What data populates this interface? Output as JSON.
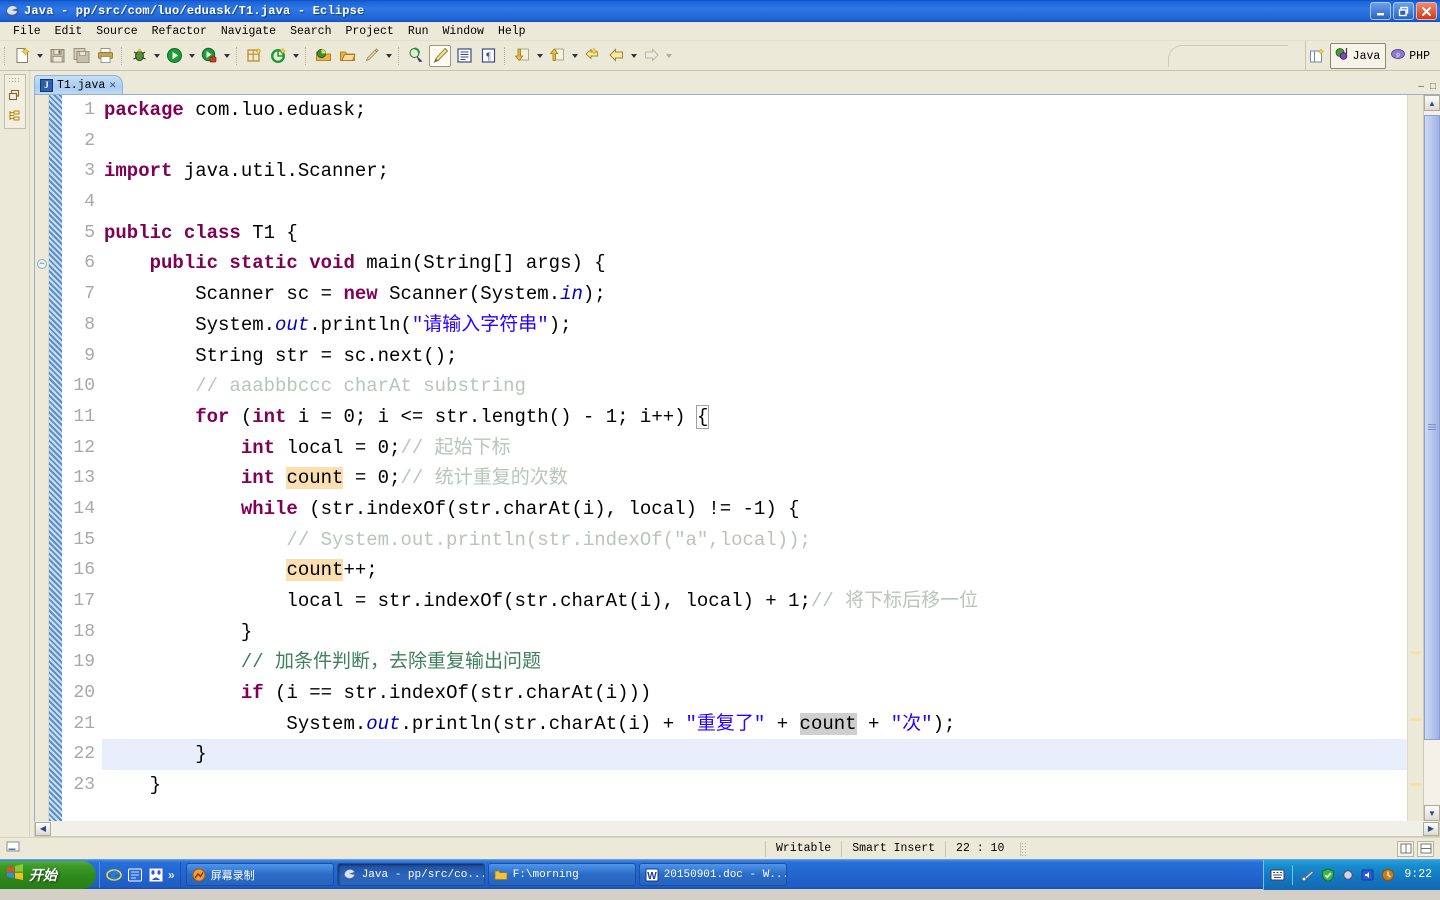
{
  "window": {
    "title": "Java - pp/src/com/luo/eduask/T1.java - Eclipse",
    "app_icon": "eclipse-icon",
    "minimize_label": "_",
    "restore_label": "❐",
    "close_label": "✕"
  },
  "menubar": {
    "items": [
      {
        "label": "File"
      },
      {
        "label": "Edit"
      },
      {
        "label": "Source"
      },
      {
        "label": "Refactor"
      },
      {
        "label": "Navigate"
      },
      {
        "label": "Search"
      },
      {
        "label": "Project"
      },
      {
        "label": "Run"
      },
      {
        "label": "Window"
      },
      {
        "label": "Help"
      }
    ]
  },
  "toolbar": {
    "buttons": [
      {
        "name": "new-wizard",
        "icon": "new-file-icon",
        "dropdown": true
      },
      {
        "name": "save",
        "icon": "save-icon",
        "dropdown": false
      },
      {
        "name": "save-all",
        "icon": "save-all-icon",
        "dropdown": false
      },
      {
        "name": "print",
        "icon": "print-icon",
        "dropdown": false
      },
      {
        "name": "debug",
        "icon": "debug-bug-icon",
        "dropdown": true
      },
      {
        "name": "run",
        "icon": "run-play-icon",
        "dropdown": true
      },
      {
        "name": "external-tools",
        "icon": "external-tools-icon",
        "dropdown": true
      },
      {
        "name": "new-java-package",
        "icon": "new-package-icon",
        "dropdown": false
      },
      {
        "name": "new-java-class",
        "icon": "new-class-icon",
        "dropdown": true
      },
      {
        "name": "open-type",
        "icon": "open-type-icon",
        "dropdown": false
      },
      {
        "name": "open-task",
        "icon": "open-task-icon",
        "dropdown": false
      },
      {
        "name": "search",
        "icon": "pencil-search-icon",
        "dropdown": true
      },
      {
        "name": "toggle-mark-occurrences",
        "icon": "mark-occurrences-icon",
        "dropdown": false
      },
      {
        "name": "toggle-block-selection",
        "icon": "block-selection-icon",
        "dropdown": false,
        "pressed": true
      },
      {
        "name": "show-whitespace",
        "icon": "whitespace-icon",
        "dropdown": false
      },
      {
        "name": "pilcrow",
        "icon": "pilcrow-icon",
        "dropdown": false
      },
      {
        "name": "next-annotation",
        "icon": "down-arrow-annotation-icon",
        "dropdown": true
      },
      {
        "name": "previous-annotation",
        "icon": "up-arrow-annotation-icon",
        "dropdown": true
      },
      {
        "name": "last-edit-location",
        "icon": "last-edit-icon",
        "dropdown": false
      },
      {
        "name": "back",
        "icon": "back-arrow-icon",
        "dropdown": true
      },
      {
        "name": "forward",
        "icon": "forward-arrow-icon",
        "dropdown": true
      }
    ]
  },
  "perspectives": {
    "open_label": "open-perspective-icon",
    "items": [
      {
        "label": "Java",
        "icon": "java-perspective-icon",
        "active": true
      },
      {
        "label": "PHP",
        "icon": "php-perspective-icon",
        "active": false
      }
    ]
  },
  "fastview": {
    "items": [
      {
        "name": "restore-view",
        "icon": "restore-icon"
      },
      {
        "name": "outline-view",
        "icon": "outline-icon"
      }
    ]
  },
  "editor": {
    "tab": {
      "label": "T1.java",
      "icon": "java-file-icon",
      "close_label": "✕"
    },
    "view_buttons": [
      {
        "name": "minimize-editor",
        "label": "–"
      },
      {
        "name": "maximize-editor",
        "label": "□"
      }
    ],
    "current_line": 22,
    "lines": [
      {
        "n": 1,
        "fold": null,
        "tokens": [
          {
            "t": "package",
            "c": "kw"
          },
          {
            "t": " com.luo.eduask;",
            "c": ""
          }
        ]
      },
      {
        "n": 2,
        "fold": null,
        "tokens": []
      },
      {
        "n": 3,
        "fold": null,
        "tokens": [
          {
            "t": "import",
            "c": "kw"
          },
          {
            "t": " java.util.Scanner;",
            "c": ""
          }
        ]
      },
      {
        "n": 4,
        "fold": null,
        "tokens": []
      },
      {
        "n": 5,
        "fold": null,
        "tokens": [
          {
            "t": "public class",
            "c": "kw"
          },
          {
            "t": " T1 {",
            "c": ""
          }
        ]
      },
      {
        "n": 6,
        "fold": "minus",
        "tokens": [
          {
            "t": "    ",
            "c": ""
          },
          {
            "t": "public static void",
            "c": "kw"
          },
          {
            "t": " main(String[] args) {",
            "c": ""
          }
        ]
      },
      {
        "n": 7,
        "fold": null,
        "tokens": [
          {
            "t": "        Scanner sc = ",
            "c": ""
          },
          {
            "t": "new",
            "c": "kw"
          },
          {
            "t": " Scanner(System.",
            "c": ""
          },
          {
            "t": "in",
            "c": "fld"
          },
          {
            "t": ");",
            "c": ""
          }
        ]
      },
      {
        "n": 8,
        "fold": null,
        "tokens": [
          {
            "t": "        System.",
            "c": ""
          },
          {
            "t": "out",
            "c": "fld"
          },
          {
            "t": ".println(",
            "c": ""
          },
          {
            "t": "\"请输入字符串\"",
            "c": "str"
          },
          {
            "t": ");",
            "c": ""
          }
        ]
      },
      {
        "n": 9,
        "fold": null,
        "tokens": [
          {
            "t": "        String str = sc.next();",
            "c": ""
          }
        ]
      },
      {
        "n": 10,
        "fold": null,
        "tokens": [
          {
            "t": "        // aaabbbccc charAt substring",
            "c": "cmt-gray"
          }
        ]
      },
      {
        "n": 11,
        "fold": null,
        "tokens": [
          {
            "t": "        ",
            "c": ""
          },
          {
            "t": "for",
            "c": "kw"
          },
          {
            "t": " (",
            "c": ""
          },
          {
            "t": "int",
            "c": "kw"
          },
          {
            "t": " i = 0; i <= str.length() - 1; i++) ",
            "c": ""
          },
          {
            "t": "{",
            "c": "brkt"
          }
        ]
      },
      {
        "n": 12,
        "fold": null,
        "tokens": [
          {
            "t": "            ",
            "c": ""
          },
          {
            "t": "int",
            "c": "kw"
          },
          {
            "t": " local = 0;",
            "c": ""
          },
          {
            "t": "// 起始下标",
            "c": "cmt-gray"
          }
        ]
      },
      {
        "n": 13,
        "fold": null,
        "tokens": [
          {
            "t": "            ",
            "c": ""
          },
          {
            "t": "int",
            "c": "kw"
          },
          {
            "t": " ",
            "c": ""
          },
          {
            "t": "count",
            "c": "hl-occ"
          },
          {
            "t": " = 0;",
            "c": ""
          },
          {
            "t": "// 统计重复的次数",
            "c": "cmt-gray"
          }
        ]
      },
      {
        "n": 14,
        "fold": null,
        "tokens": [
          {
            "t": "            ",
            "c": ""
          },
          {
            "t": "while",
            "c": "kw"
          },
          {
            "t": " (str.indexOf(str.charAt(i), local) != -1) {",
            "c": ""
          }
        ]
      },
      {
        "n": 15,
        "fold": null,
        "tokens": [
          {
            "t": "                // System.out.println(str.indexOf(\"a\",local));",
            "c": "cmt-gray"
          }
        ]
      },
      {
        "n": 16,
        "fold": null,
        "tokens": [
          {
            "t": "                ",
            "c": ""
          },
          {
            "t": "count",
            "c": "hl-occ"
          },
          {
            "t": "++;",
            "c": ""
          }
        ]
      },
      {
        "n": 17,
        "fold": null,
        "tokens": [
          {
            "t": "                local = str.indexOf(str.charAt(i), local) + 1;",
            "c": ""
          },
          {
            "t": "// 将下标后移一位",
            "c": "cmt-gray"
          }
        ]
      },
      {
        "n": 18,
        "fold": null,
        "tokens": [
          {
            "t": "            }",
            "c": ""
          }
        ]
      },
      {
        "n": 19,
        "fold": null,
        "tokens": [
          {
            "t": "            // 加条件判断，去除重复输出问题",
            "c": "cmt"
          }
        ]
      },
      {
        "n": 20,
        "fold": null,
        "tokens": [
          {
            "t": "            ",
            "c": ""
          },
          {
            "t": "if",
            "c": "kw"
          },
          {
            "t": " (i == str.indexOf(str.charAt(i)))",
            "c": ""
          }
        ]
      },
      {
        "n": 21,
        "fold": null,
        "tokens": [
          {
            "t": "                System.",
            "c": ""
          },
          {
            "t": "out",
            "c": "fld"
          },
          {
            "t": ".println(str.charAt(i) + ",
            "c": ""
          },
          {
            "t": "\"重复了\"",
            "c": "str"
          },
          {
            "t": " + ",
            "c": ""
          },
          {
            "t": "count",
            "c": "hl-sel"
          },
          {
            "t": " + ",
            "c": ""
          },
          {
            "t": "\"次\"",
            "c": "str"
          },
          {
            "t": ");",
            "c": ""
          }
        ]
      },
      {
        "n": 22,
        "fold": null,
        "tokens": [
          {
            "t": "        }",
            "c": ""
          }
        ]
      },
      {
        "n": 23,
        "fold": null,
        "tokens": [
          {
            "t": "    }",
            "c": ""
          }
        ]
      }
    ]
  },
  "statusbar": {
    "writable": "Writable",
    "insert_mode": "Smart Insert",
    "position": "22 : 10",
    "right_icons": [
      {
        "name": "tile-editors-icon"
      },
      {
        "name": "editor-layout-icon"
      }
    ]
  },
  "taskbar": {
    "start_label": "开始",
    "quicklaunch": [
      {
        "name": "internet-explorer-icon",
        "glyph": "e"
      },
      {
        "name": "show-desktop-icon",
        "glyph": "▣"
      },
      {
        "name": "baidu-icon",
        "glyph": "熊"
      }
    ],
    "quicklaunch_more": "»",
    "tasks": [
      {
        "label": "屏幕录制",
        "icon": "recorder-icon",
        "active": false
      },
      {
        "label": "Java - pp/src/co...",
        "icon": "eclipse-icon",
        "active": true
      },
      {
        "label": "F:\\morning",
        "icon": "folder-icon",
        "active": false
      },
      {
        "label": "20150901.doc - W...",
        "icon": "word-icon",
        "active": false
      }
    ],
    "tray": {
      "icons": [
        {
          "name": "keyboard-layout-icon"
        },
        {
          "name": "network-icon"
        },
        {
          "name": "safe-shield-icon"
        },
        {
          "name": "settings-icon"
        },
        {
          "name": "volume-icon"
        },
        {
          "name": "updates-icon"
        }
      ],
      "time": "9:22"
    }
  },
  "colors": {
    "keyword": "#7f0055",
    "string": "#2a00ff",
    "comment": "#3f7f5f",
    "field": "#0000c0",
    "occurrence_highlight": "#fbdfb0",
    "selection_highlight": "#cfcfcf",
    "current_line": "#e8eefb",
    "chrome": "#ece9d8",
    "titlebar": "#2f78e4"
  }
}
